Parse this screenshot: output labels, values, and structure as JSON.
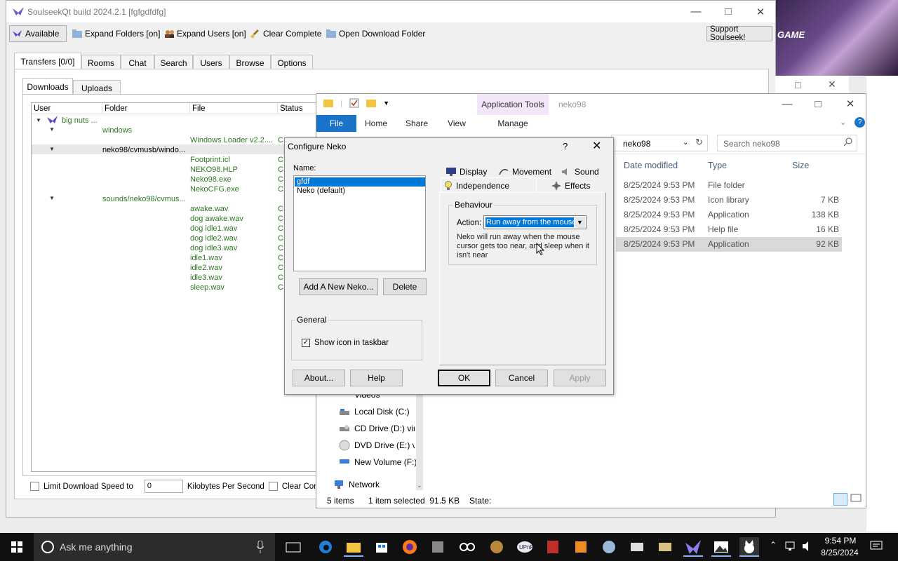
{
  "soulseek": {
    "title": "SoulseekQt build 2024.2.1 [fgfgdfdfg]",
    "toolbar": {
      "available": "Available",
      "expand_folders": "Expand Folders [on]",
      "expand_users": "Expand Users [on]",
      "clear_complete": "Clear Complete",
      "open_download_folder": "Open Download Folder",
      "support": "Support Soulseek!"
    },
    "tabs": [
      "Transfers [0/0]",
      "Rooms",
      "Chat",
      "Search",
      "Users",
      "Browse",
      "Options"
    ],
    "subtabs": [
      "Downloads",
      "Uploads"
    ],
    "columns": [
      "User",
      "Folder",
      "File",
      "Status"
    ],
    "rows": {
      "user": "big nuts ...",
      "folder1": "windows",
      "file1": "Windows Loader v2.2....",
      "folder2": "neko98/cvmusb/windo...",
      "files2": [
        "Footprint.icl",
        "NEKO98.HLP",
        "Neko98.exe",
        "NekoCFG.exe"
      ],
      "folder3": "sounds/neko98/cvmus...",
      "files3": [
        "awake.wav",
        "dog awake.wav",
        "dog idle1.wav",
        "dog idle2.wav",
        "dog idle3.wav",
        "idle1.wav",
        "idle2.wav",
        "idle3.wav",
        "sleep.wav"
      ],
      "status_glyph": "C"
    },
    "bottom": {
      "limit_label": "Limit Download Speed to",
      "speed_value": "0",
      "unit": "Kilobytes Per Second",
      "clear_label": "Clear Complete"
    }
  },
  "explorer": {
    "ribbon": {
      "file": "File",
      "home": "Home",
      "share": "Share",
      "view": "View",
      "app_tools": "Application Tools",
      "manage": "Manage",
      "folder_title": "neko98"
    },
    "address": "neko98",
    "search_placeholder": "Search neko98",
    "columns": {
      "date": "Date modified",
      "type": "Type",
      "size": "Size"
    },
    "files": [
      {
        "date": "8/25/2024 9:53 PM",
        "type": "File folder",
        "size": ""
      },
      {
        "date": "8/25/2024 9:53 PM",
        "type": "Icon library",
        "size": "7 KB"
      },
      {
        "date": "8/25/2024 9:53 PM",
        "type": "Application",
        "size": "138 KB"
      },
      {
        "date": "8/25/2024 9:53 PM",
        "type": "Help file",
        "size": "16 KB"
      },
      {
        "date": "8/25/2024 9:53 PM",
        "type": "Application",
        "size": "92 KB"
      }
    ],
    "nav": {
      "videos": "Videos",
      "local_disk": "Local Disk (C:)",
      "cd_drive": "CD Drive (D:) virt",
      "dvd_drive": "DVD Drive (E:) vi",
      "new_volume": "New Volume (F:)",
      "network": "Network"
    },
    "status": {
      "items": "5 items",
      "selected": "1 item selected  91.5 KB",
      "state": "State:"
    }
  },
  "dialog": {
    "title": "Configure Neko",
    "help_glyph": "?",
    "name_label": "Name:",
    "names": [
      "gfdf",
      "Neko (default)"
    ],
    "add_button": "Add A New Neko...",
    "delete_button": "Delete",
    "general_label": "General",
    "show_icon_label": "Show icon in taskbar",
    "tabs": {
      "display": "Display",
      "movement": "Movement",
      "sound": "Sound",
      "independence": "Independence",
      "effects": "Effects"
    },
    "behaviour_label": "Behaviour",
    "action_label": "Action:",
    "action_value": "Run away from the mouse",
    "description": "Neko will run away when the mouse cursor gets too near, and sleep when it isn't near",
    "about": "About...",
    "help": "Help",
    "ok": "OK",
    "cancel": "Cancel",
    "apply": "Apply"
  },
  "taskbar": {
    "search_placeholder": "Ask me anything",
    "time": "9:54 PM",
    "date": "8/25/2024"
  },
  "background": {
    "game_text": "GAME"
  }
}
